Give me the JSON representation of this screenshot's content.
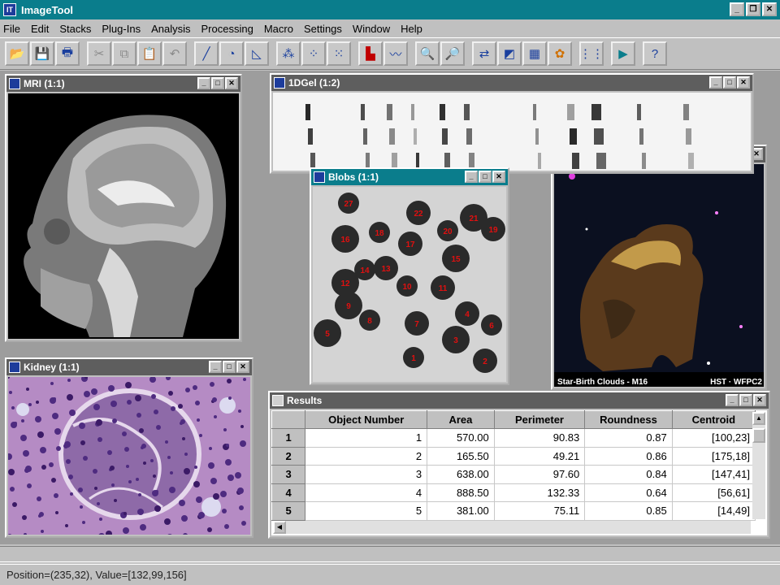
{
  "app": {
    "title": "ImageTool",
    "icon_text": "IT"
  },
  "menu": [
    "File",
    "Edit",
    "Stacks",
    "Plug-Ins",
    "Analysis",
    "Processing",
    "Macro",
    "Settings",
    "Window",
    "Help"
  ],
  "windows": {
    "mri": {
      "title": "MRI (1:1)"
    },
    "gel": {
      "title": "1DGel (1:2)"
    },
    "blobs": {
      "title": "Blobs (1:1)",
      "labels": [
        "27",
        "22",
        "21",
        "20",
        "19",
        "16",
        "18",
        "17",
        "15",
        "14",
        "13",
        "12",
        "10",
        "11",
        "9",
        "8",
        "7",
        "5",
        "6",
        "4",
        "3",
        "1",
        "2"
      ]
    },
    "stars": {
      "caption_left": "Star-Birth Clouds - M16",
      "caption_right": "HST · WFPC2"
    },
    "kidney": {
      "title": "Kidney (1:1)"
    },
    "results": {
      "title": "Results",
      "columns": [
        "Object Number",
        "Area",
        "Perimeter",
        "Roundness",
        "Centroid"
      ],
      "rows": [
        {
          "idx": "1",
          "obj": "1",
          "area": "570.00",
          "perim": "90.83",
          "round": "0.87",
          "cent": "[100,23]"
        },
        {
          "idx": "2",
          "obj": "2",
          "area": "165.50",
          "perim": "49.21",
          "round": "0.86",
          "cent": "[175,18]"
        },
        {
          "idx": "3",
          "obj": "3",
          "area": "638.00",
          "perim": "97.60",
          "round": "0.84",
          "cent": "[147,41]"
        },
        {
          "idx": "4",
          "obj": "4",
          "area": "888.50",
          "perim": "132.33",
          "round": "0.64",
          "cent": "[56,61]"
        },
        {
          "idx": "5",
          "obj": "5",
          "area": "381.00",
          "perim": "75.11",
          "round": "0.85",
          "cent": "[14,49]"
        }
      ]
    }
  },
  "status": {
    "text": "Position=(235,32), Value=[132,99,156]"
  }
}
